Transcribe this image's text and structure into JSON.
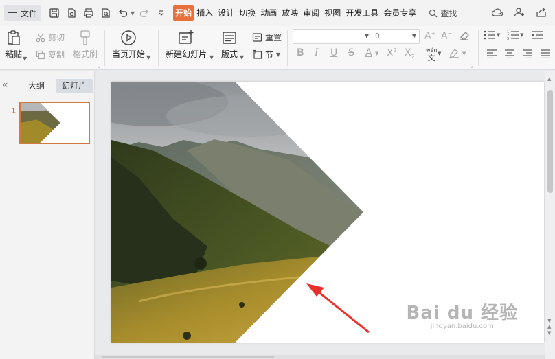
{
  "menubar": {
    "file_label": "文件",
    "tabs": [
      "开始",
      "插入",
      "设计",
      "切换",
      "动画",
      "放映",
      "审阅",
      "视图",
      "开发工具",
      "会员专享"
    ],
    "active_tab": "开始",
    "search_label": "查找"
  },
  "ribbon": {
    "paste": "粘贴",
    "cut": "剪切",
    "copy": "复制",
    "format_painter": "格式刷",
    "play_from_current": "当页开始",
    "new_slide": "新建幻灯片",
    "layout": "版式",
    "reset": "重置",
    "section": "节",
    "font_size_value": "0",
    "wen_label": "wén"
  },
  "left_panel": {
    "tab_outline": "大纲",
    "tab_slides": "幻灯片",
    "active": "幻灯片",
    "slide_number": "1"
  },
  "watermark": {
    "main": "Bai du 经验",
    "sub": "jingyan.baidu.com"
  },
  "colors": {
    "accent": "#e8703a",
    "thumb_border": "#d07a40",
    "arrow": "#e8312c"
  }
}
